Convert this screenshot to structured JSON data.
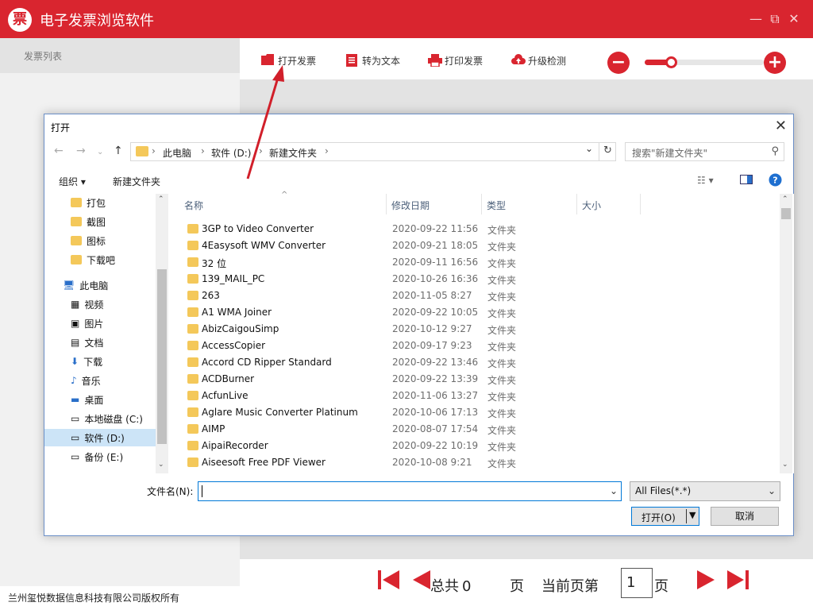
{
  "app": {
    "logo_char": "票",
    "title": "电子发票浏览软件",
    "controls": [
      "—",
      "⧉",
      "✕"
    ]
  },
  "left_panel": {
    "header": "发票列表"
  },
  "toolbar": {
    "open": "打开发票",
    "to_text": "转为文本",
    "print": "打印发票",
    "upgrade": "升级检测",
    "zoom_level": 0.22
  },
  "footer": {
    "copyright": "兰州玺悦数据信息科技有限公司版权所有",
    "total_label": "总共",
    "total_count": "0",
    "page_unit": "页",
    "current_label": "当前页第",
    "current_page": "1",
    "page_unit2": "页"
  },
  "dialog": {
    "title": "打开",
    "breadcrumbs": [
      "此电脑",
      "软件 (D:)",
      "新建文件夹"
    ],
    "search_placeholder": "搜索\"新建文件夹\"",
    "organize": "组织 ▾",
    "new_folder": "新建文件夹",
    "nav": {
      "quick": [
        "打包",
        "截图",
        "图标",
        "下载吧"
      ],
      "pc": "此电脑",
      "pc_items": [
        "视频",
        "图片",
        "文档",
        "下载",
        "音乐",
        "桌面",
        "本地磁盘 (C:)",
        "软件 (D:)",
        "备份 (E:)"
      ]
    },
    "columns": [
      "名称",
      "修改日期",
      "类型",
      "大小"
    ],
    "files": [
      {
        "name": "3GP to Video Converter",
        "date": "2020-09-22 11:56",
        "type": "文件夹"
      },
      {
        "name": "4Easysoft WMV Converter",
        "date": "2020-09-21 18:05",
        "type": "文件夹"
      },
      {
        "name": "32 位",
        "date": "2020-09-11 16:56",
        "type": "文件夹"
      },
      {
        "name": "139_MAIL_PC",
        "date": "2020-10-26 16:36",
        "type": "文件夹"
      },
      {
        "name": "263",
        "date": "2020-11-05 8:27",
        "type": "文件夹"
      },
      {
        "name": "A1 WMA Joiner",
        "date": "2020-09-22 10:05",
        "type": "文件夹"
      },
      {
        "name": "AbizCaigouSimp",
        "date": "2020-10-12 9:27",
        "type": "文件夹"
      },
      {
        "name": "AccessCopier",
        "date": "2020-09-17 9:23",
        "type": "文件夹"
      },
      {
        "name": "Accord CD Ripper Standard",
        "date": "2020-09-22 13:46",
        "type": "文件夹"
      },
      {
        "name": "ACDBurner",
        "date": "2020-09-22 13:39",
        "type": "文件夹"
      },
      {
        "name": "AcfunLive",
        "date": "2020-11-06 13:27",
        "type": "文件夹"
      },
      {
        "name": "Aglare Music Converter Platinum",
        "date": "2020-10-06 17:13",
        "type": "文件夹"
      },
      {
        "name": "AIMP",
        "date": "2020-08-07 17:54",
        "type": "文件夹"
      },
      {
        "name": "AipaiRecorder",
        "date": "2020-09-22 10:19",
        "type": "文件夹"
      },
      {
        "name": "Aiseesoft Free PDF Viewer",
        "date": "2020-10-08 9:21",
        "type": "文件夹"
      }
    ],
    "filename_label": "文件名(N):",
    "filename_value": "",
    "filter": "All Files(*.*)",
    "open_btn": "打开(O)",
    "cancel_btn": "取消"
  }
}
